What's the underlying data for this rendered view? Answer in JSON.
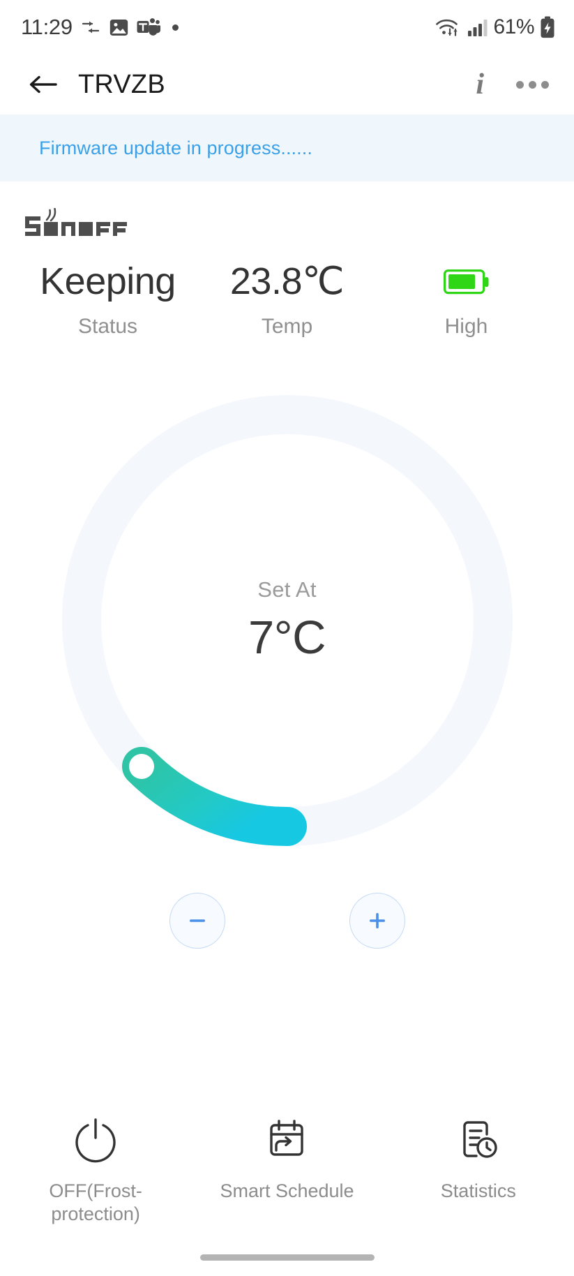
{
  "statusbar": {
    "time": "11:29",
    "battery_percent": "61%",
    "icons": [
      "data-transfer-icon",
      "image-icon",
      "teams-icon",
      "dot-indicator",
      "wifi-icon",
      "cellular-signal-icon",
      "battery-charging-icon"
    ]
  },
  "header": {
    "title": "TRVZB",
    "back_icon": "back-arrow-icon",
    "info_icon": "info-icon",
    "info_glyph": "i",
    "more_icon": "more-options-icon"
  },
  "banner": {
    "text": "Firmware update in progress......",
    "text_color": "#3aa0e8",
    "bg_color": "#eff7fd"
  },
  "brand": {
    "name": "SONOFF"
  },
  "summary": [
    {
      "value": "Keeping",
      "label": "Status",
      "type": "text"
    },
    {
      "value": "23.8℃",
      "label": "Temp",
      "type": "text"
    },
    {
      "value": "",
      "label": "High",
      "type": "battery",
      "color": "#2fd615"
    }
  ],
  "dial": {
    "set_label": "Set At",
    "set_value": "7°C",
    "track_color": "#f4f7fc",
    "arc_start_color": "#2ec4a5",
    "arc_end_color": "#17c8e3",
    "knob_color": "#ffffff"
  },
  "steppers": {
    "minus_label": "−",
    "plus_label": "+",
    "accent": "#4a90e8",
    "minus_icon": "minus-icon",
    "plus_icon": "plus-icon"
  },
  "bottom_nav": [
    {
      "label": "OFF(Frost-protection)",
      "icon": "power-icon"
    },
    {
      "label": "Smart Schedule",
      "icon": "calendar-arrow-icon"
    },
    {
      "label": "Statistics",
      "icon": "document-clock-icon"
    }
  ]
}
